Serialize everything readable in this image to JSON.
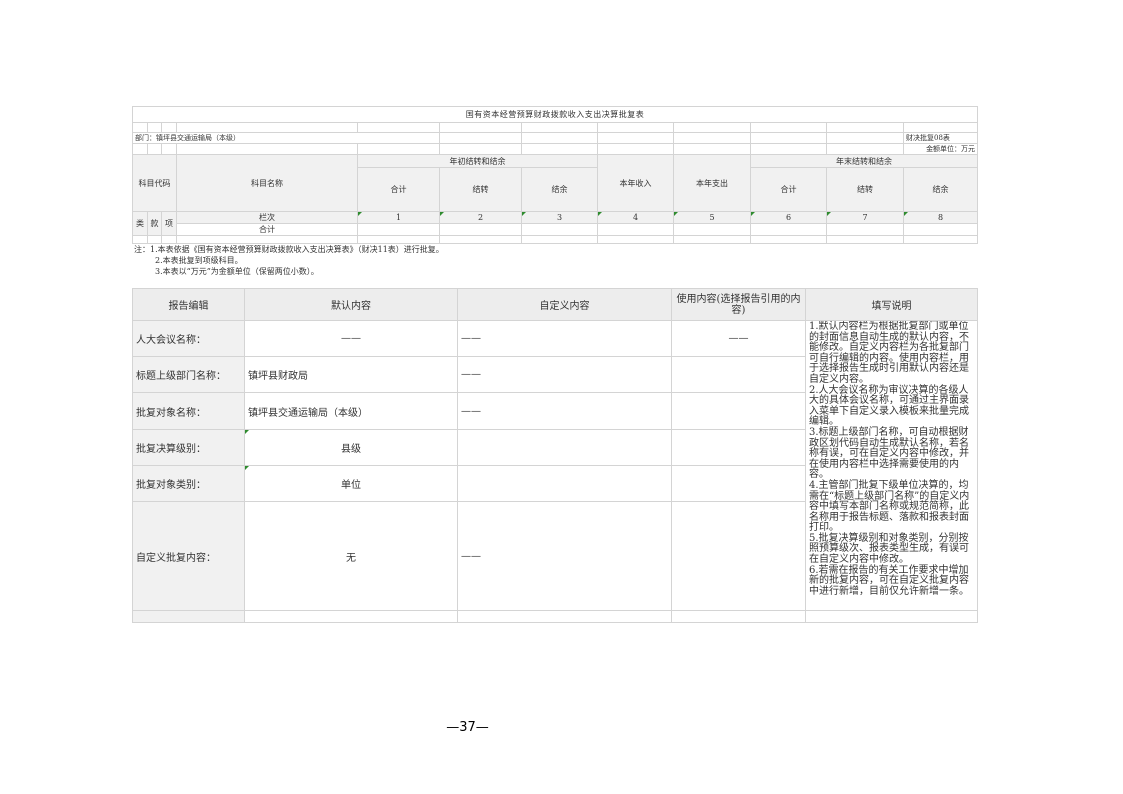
{
  "sheet": {
    "title": "国有资本经营预算财政拨款收入支出决算批复表",
    "department": "部门：镇坪县交通运输局（本级）",
    "table_code": "财决批复08表",
    "unit": "金额单位：万元",
    "col_subject_code": "科目代码",
    "col_subject_name": "科目名称",
    "group_start": "年初结转和结余",
    "group_end": "年末结转和结余",
    "col_total": "合计",
    "col_carry": "结转",
    "col_surplus": "结余",
    "col_income": "本年收入",
    "col_expense": "本年支出",
    "cat_lei": "类",
    "cat_kuan": "款",
    "cat_xiang": "项",
    "row_column_no": "栏次",
    "row_total": "合计",
    "col_numbers": [
      "1",
      "2",
      "3",
      "4",
      "5",
      "6",
      "7",
      "8"
    ]
  },
  "notes": {
    "line1": "注：1.本表依据《国有资本经营预算财政拨款收入支出决算表》（财决11表）进行批复。",
    "line2": "2.本表批复到项级科目。",
    "line3": "3.本表以“万元”为金额单位（保留两位小数）。"
  },
  "report": {
    "header_edit": "报告编辑",
    "header_default": "默认内容",
    "header_custom": "自定义内容",
    "header_use": "使用内容(选择报告引用的内容)",
    "header_explain": "填写说明",
    "rows": [
      {
        "label": "人大会议名称：",
        "default": "——",
        "custom": "——",
        "use": "——"
      },
      {
        "label": "标题上级部门名称：",
        "default": "镇坪县财政局",
        "custom": "——"
      },
      {
        "label": "批复对象名称：",
        "default": "镇坪县交通运输局（本级）",
        "custom": "——"
      },
      {
        "label": "批复决算级别：",
        "default": "县级"
      },
      {
        "label": "批复对象类别：",
        "default": "单位"
      },
      {
        "label": "自定义批复内容：",
        "default": "无",
        "custom": "——"
      }
    ],
    "explain": [
      "1.默认内容栏为根据批复部门或单位的封面信息自动生成的默认内容，不能修改。自定义内容栏为各批复部门可自行编辑的内容。使用内容栏，用于选择报告生成时引用默认内容还是自定义内容。",
      "2.人大会议名称为审议决算的各级人大的具体会议名称，可通过主界面录入菜单下自定义录入模板来批量完成编辑。",
      "3.标题上级部门名称，可自动根据财政区划代码自动生成默认名称，若名称有误，可在自定义内容中修改，并在使用内容栏中选择需要使用的内容。",
      "4.主管部门批复下级单位决算的，均需在“标题上级部门名称”的自定义内容中填写本部门名称或规范简称，此名称用于报告标题、落款和报表封面打印。",
      "5.批复决算级别和对象类别，分别按照预算级次、报表类型生成，有误可在自定义内容中修改。",
      "6.若需在报告的有关工作要求中增加新的批复内容，可在自定义批复内容中进行新增，目前仅允许新增一条。"
    ]
  },
  "page_number": "—37—"
}
